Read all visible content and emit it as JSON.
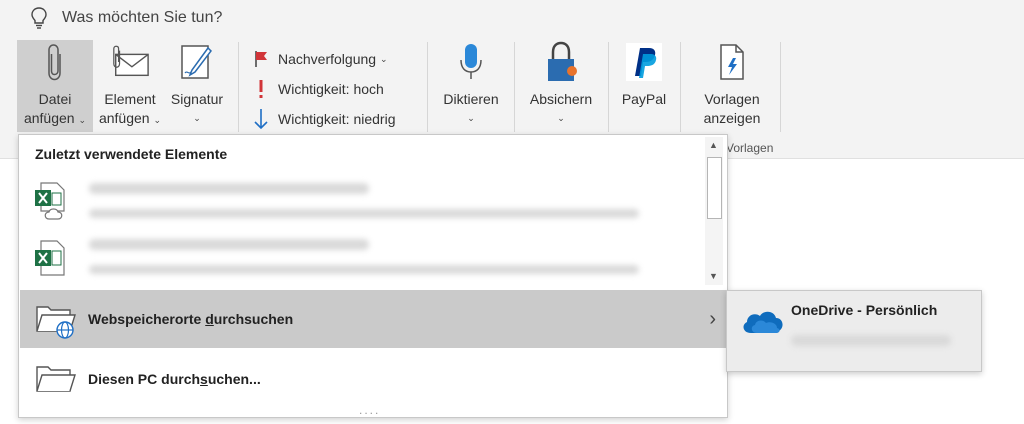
{
  "tellme": {
    "placeholder": "Was möchten Sie tun?"
  },
  "ribbon": {
    "attach_file": {
      "line1": "Datei",
      "line2": "anfügen"
    },
    "attach_item": {
      "line1": "Element",
      "line2": "anfügen"
    },
    "signature": {
      "label": "Signatur"
    },
    "followup": {
      "label": "Nachverfolgung"
    },
    "importance_high": {
      "label": "Wichtigkeit: hoch"
    },
    "importance_low": {
      "label": "Wichtigkeit: niedrig"
    },
    "dictate": {
      "label": "Diktieren"
    },
    "protect": {
      "label": "Absichern"
    },
    "paypal": {
      "label": "PayPal"
    },
    "templates": {
      "line1": "Vorlagen",
      "line2": "anzeigen",
      "group_label": "Vorlagen"
    }
  },
  "menu": {
    "title": "Zuletzt verwendete Elemente",
    "browse_web": {
      "before": "Webspeicherorte ",
      "accel": "d",
      "after": "urchsuchen"
    },
    "browse_pc": {
      "before": "Diesen PC durch",
      "accel": "s",
      "after": "uchen..."
    },
    "grip": "....",
    "submenu_arrow": "›"
  },
  "submenu": {
    "onedrive": "OneDrive - Persönlich"
  },
  "icons": {
    "tellme": "lightbulb-icon",
    "attach_file": "paperclip-icon",
    "attach_item": "envelope-paperclip-icon",
    "signature": "signature-pen-icon",
    "followup": "red-flag-icon",
    "importance_high": "red-exclamation-icon",
    "importance_low": "blue-down-arrow-icon",
    "dictate": "microphone-icon",
    "protect": "padlock-icon",
    "paypal": "paypal-logo-icon",
    "templates": "template-icon",
    "excel": "excel-file-icon",
    "web_folder": "folder-globe-icon",
    "pc_folder": "folder-icon",
    "onedrive": "onedrive-cloud-icon"
  },
  "colors": {
    "ribbon_bg": "#f3f3f3",
    "pressed": "#cfcfcf",
    "highlight": "#cacaca",
    "excel_green": "#1e7145",
    "onedrive_blue": "#0f6cbd",
    "flag_red": "#d13438"
  }
}
